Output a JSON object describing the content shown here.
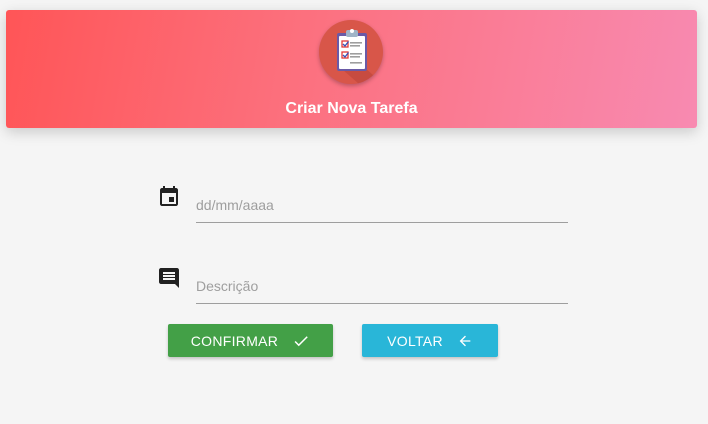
{
  "header": {
    "title": "Criar Nova Tarefa",
    "logo_icon": "clipboard-checklist-icon",
    "gradient_start": "#ff5557",
    "gradient_end": "#f88ab1"
  },
  "form": {
    "date": {
      "icon": "calendar-icon",
      "value": "",
      "placeholder": "dd/mm/aaaa"
    },
    "description": {
      "icon": "comment-icon",
      "value": "",
      "placeholder": "Descrição"
    }
  },
  "buttons": {
    "confirm": {
      "label": "CONFIRMAR",
      "icon": "check-icon",
      "color": "#43a047"
    },
    "back": {
      "label": "VOLTAR",
      "icon": "arrow-left-icon",
      "color": "#29b6d8"
    }
  }
}
